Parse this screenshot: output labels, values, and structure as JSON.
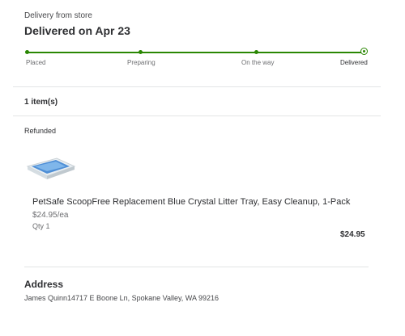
{
  "order": {
    "delivery_type": "Delivery from store",
    "status_title": "Delivered on Apr 23"
  },
  "progress": {
    "steps": [
      {
        "label": "Placed"
      },
      {
        "label": "Preparing"
      },
      {
        "label": "On the way"
      },
      {
        "label": "Delivered"
      }
    ],
    "current_step": "Delivered",
    "color": "#2a8703"
  },
  "items": {
    "count_label": "1 item(s)",
    "group_status": "Refunded",
    "list": [
      {
        "name": "PetSafe ScoopFree Replacement Blue Crystal Litter Tray, Easy Cleanup, 1-Pack",
        "unit_price": "$24.95/ea",
        "quantity": "Qty 1",
        "total": "$24.95",
        "image_icon": "litter-tray-product-image"
      }
    ]
  },
  "address": {
    "title": "Address",
    "text": "James Quinn14717 E Boone Ln, Spokane Valley, WA 99216"
  }
}
